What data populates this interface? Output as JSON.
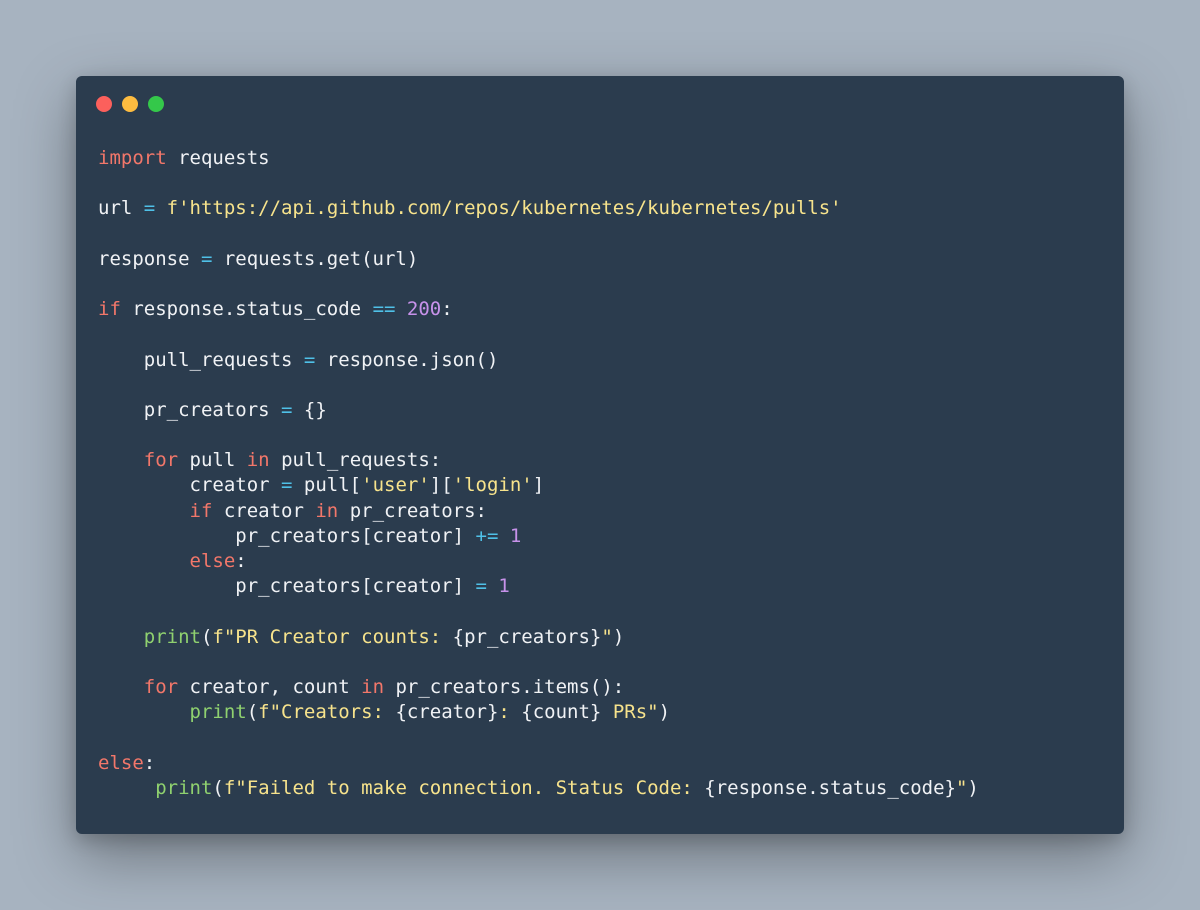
{
  "window": {
    "controls": [
      {
        "name": "close-button",
        "color": "#fc605c"
      },
      {
        "name": "minimize-button",
        "color": "#fdbc40"
      },
      {
        "name": "maximize-button",
        "color": "#34c84a"
      }
    ]
  },
  "colors": {
    "background": "#a7b3c0",
    "editor_bg": "#2b3c4e",
    "plain": "#f0f2f5",
    "keyword": "#f2776a",
    "operator": "#4fc1e8",
    "string": "#f7e38c",
    "number": "#c792ea",
    "builtin": "#8fd16f"
  },
  "code_lines": [
    [
      [
        "keyword",
        "import"
      ],
      [
        "plain",
        " requests"
      ]
    ],
    [],
    [
      [
        "plain",
        "url "
      ],
      [
        "operator",
        "="
      ],
      [
        "plain",
        " "
      ],
      [
        "string",
        "f'https://api.github.com/repos/kubernetes/kubernetes/pulls'"
      ]
    ],
    [],
    [
      [
        "plain",
        "response "
      ],
      [
        "operator",
        "="
      ],
      [
        "plain",
        " requests.get(url)"
      ]
    ],
    [],
    [
      [
        "keyword",
        "if"
      ],
      [
        "plain",
        " response.status_code "
      ],
      [
        "operator",
        "=="
      ],
      [
        "plain",
        " "
      ],
      [
        "number",
        "200"
      ],
      [
        "plain",
        ":"
      ]
    ],
    [],
    [
      [
        "plain",
        "    pull_requests "
      ],
      [
        "operator",
        "="
      ],
      [
        "plain",
        " response.json()"
      ]
    ],
    [],
    [
      [
        "plain",
        "    pr_creators "
      ],
      [
        "operator",
        "="
      ],
      [
        "plain",
        " {}"
      ]
    ],
    [],
    [
      [
        "plain",
        "    "
      ],
      [
        "keyword",
        "for"
      ],
      [
        "plain",
        " pull "
      ],
      [
        "keyword",
        "in"
      ],
      [
        "plain",
        " pull_requests:"
      ]
    ],
    [
      [
        "plain",
        "        creator "
      ],
      [
        "operator",
        "="
      ],
      [
        "plain",
        " pull["
      ],
      [
        "string",
        "'user'"
      ],
      [
        "plain",
        "]["
      ],
      [
        "string",
        "'login'"
      ],
      [
        "plain",
        "]"
      ]
    ],
    [
      [
        "plain",
        "        "
      ],
      [
        "keyword",
        "if"
      ],
      [
        "plain",
        " creator "
      ],
      [
        "keyword",
        "in"
      ],
      [
        "plain",
        " pr_creators:"
      ]
    ],
    [
      [
        "plain",
        "            pr_creators[creator] "
      ],
      [
        "operator",
        "+="
      ],
      [
        "plain",
        " "
      ],
      [
        "number",
        "1"
      ]
    ],
    [
      [
        "plain",
        "        "
      ],
      [
        "keyword",
        "else"
      ],
      [
        "plain",
        ":"
      ]
    ],
    [
      [
        "plain",
        "            pr_creators[creator] "
      ],
      [
        "operator",
        "="
      ],
      [
        "plain",
        " "
      ],
      [
        "number",
        "1"
      ]
    ],
    [],
    [
      [
        "plain",
        "    "
      ],
      [
        "builtin",
        "print"
      ],
      [
        "plain",
        "("
      ],
      [
        "string",
        "f\"PR Creator counts: "
      ],
      [
        "plain",
        "{pr_creators}"
      ],
      [
        "string",
        "\""
      ],
      [
        "plain",
        ")"
      ]
    ],
    [],
    [
      [
        "plain",
        "    "
      ],
      [
        "keyword",
        "for"
      ],
      [
        "plain",
        " creator, count "
      ],
      [
        "keyword",
        "in"
      ],
      [
        "plain",
        " pr_creators.items():"
      ]
    ],
    [
      [
        "plain",
        "        "
      ],
      [
        "builtin",
        "print"
      ],
      [
        "plain",
        "("
      ],
      [
        "string",
        "f\"Creators: "
      ],
      [
        "plain",
        "{creator}"
      ],
      [
        "string",
        ": "
      ],
      [
        "plain",
        "{count}"
      ],
      [
        "string",
        " PRs\""
      ],
      [
        "plain",
        ")"
      ]
    ],
    [],
    [
      [
        "keyword",
        "else"
      ],
      [
        "plain",
        ":"
      ]
    ],
    [
      [
        "plain",
        "     "
      ],
      [
        "builtin",
        "print"
      ],
      [
        "plain",
        "("
      ],
      [
        "string",
        "f\"Failed to make connection. Status Code: "
      ],
      [
        "plain",
        "{response.status_code}"
      ],
      [
        "string",
        "\""
      ],
      [
        "plain",
        ")"
      ]
    ]
  ]
}
